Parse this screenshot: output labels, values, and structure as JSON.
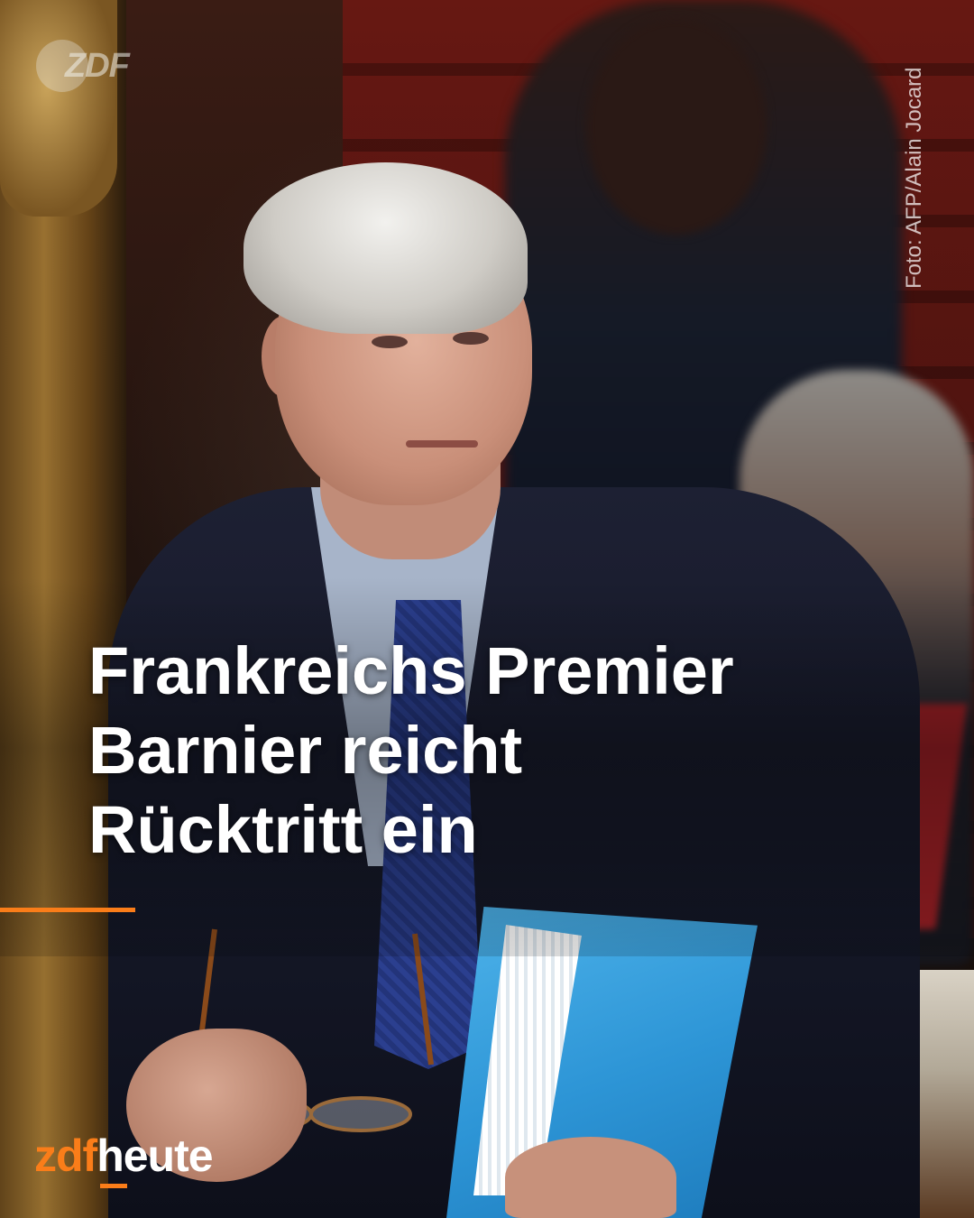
{
  "post": {
    "headline_lines": [
      "Frankreichs Premier",
      "Barnier reicht",
      "Rücktritt ein"
    ],
    "photo_credit": "Foto: AFP/Alain Jocard",
    "corner_mark": "ZDF",
    "brand": {
      "part1": "zdf",
      "part2": "heute"
    }
  },
  "colors": {
    "accent": "#fa7d19",
    "headline_text": "#ffffff",
    "folder_blue": "#2d95d6",
    "tie_blue": "#2b3f8f",
    "background_red": "#6f1712"
  },
  "icons": {
    "corner_logo": "zdf-logo-icon",
    "glasses": "eyeglasses-icon"
  }
}
